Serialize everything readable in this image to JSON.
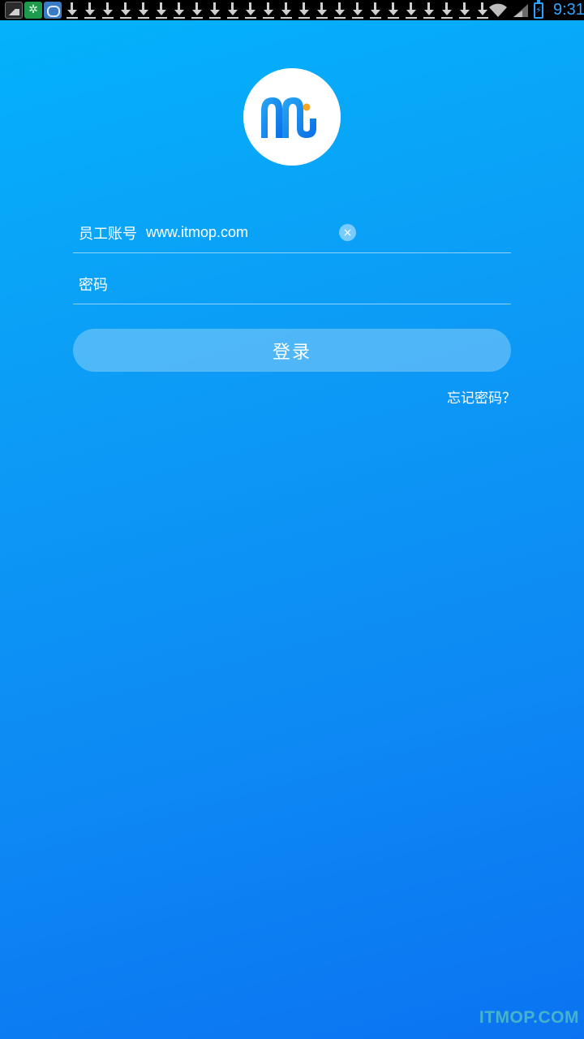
{
  "status_bar": {
    "time": "9:31",
    "notification_icons": [
      "gallery-icon",
      "green-app-icon",
      "blue-app-icon"
    ],
    "download_count": 24,
    "battery_color": "#29a3ff"
  },
  "logo": {
    "brand": "m-logo",
    "accent_color": "#f5a623"
  },
  "form": {
    "account_label": "员工账号",
    "account_value": "www.itmop.com",
    "password_label": "密码",
    "password_value": "",
    "clear_icon": "×",
    "login_label": "登录",
    "forgot_label": "忘记密码？"
  },
  "watermark": "ITMOP.COM",
  "colors": {
    "background_top": "#03b3fb",
    "background_bottom": "#0b73f1",
    "text": "#ffffff"
  }
}
